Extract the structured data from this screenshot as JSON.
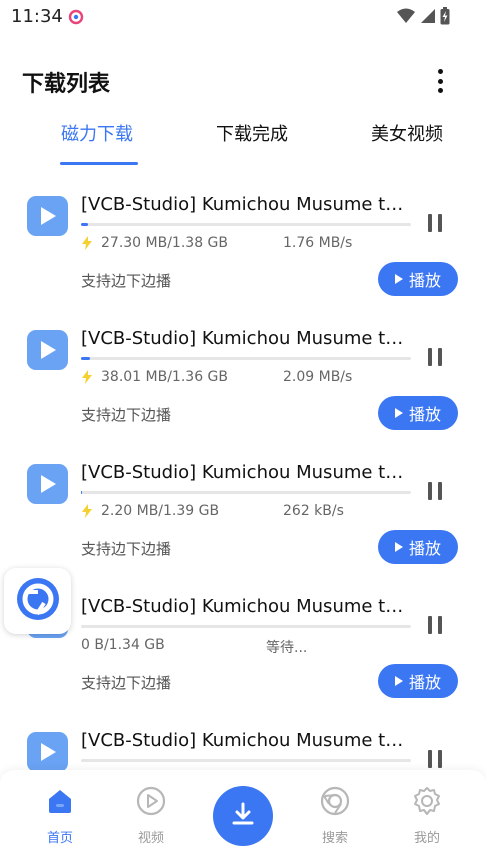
{
  "status_bar": {
    "time": "11:34",
    "icons": [
      "app-notification-icon",
      "wifi-icon",
      "cellular-signal-icon",
      "battery-charging-icon"
    ]
  },
  "header": {
    "title": "下载列表",
    "more_icon": "more-vertical-icon"
  },
  "tabs": [
    {
      "label": "磁力下载",
      "active": true
    },
    {
      "label": "下载完成",
      "active": false
    },
    {
      "label": "美女视频",
      "active": false
    }
  ],
  "downloads": [
    {
      "title": "[VCB-Studio] Kumichou Musume to S...",
      "size": "27.30 MB/1.38 GB",
      "speed": "1.76 MB/s",
      "progress": 0.02,
      "boosted": true,
      "hint": "支持边下边播",
      "play_label": "播放"
    },
    {
      "title": "[VCB-Studio] Kumichou Musume to S...",
      "size": "38.01 MB/1.36 GB",
      "speed": "2.09 MB/s",
      "progress": 0.027,
      "boosted": true,
      "hint": "支持边下边播",
      "play_label": "播放"
    },
    {
      "title": "[VCB-Studio] Kumichou Musume to S...",
      "size": "2.20 MB/1.39 GB",
      "speed": "262 kB/s",
      "progress": 0.002,
      "boosted": true,
      "hint": "支持边下边播",
      "play_label": "播放"
    },
    {
      "title": "[VCB-Studio] Kumichou Musume to S...",
      "size": "0 B/1.34 GB",
      "speed": "等待...",
      "progress": 0,
      "boosted": false,
      "hint": "支持边下边播",
      "play_label": "播放"
    },
    {
      "title": "[VCB-Studio] Kumichou Musume to S...",
      "size": "",
      "speed": "",
      "progress": 0,
      "boosted": false,
      "hint": "",
      "play_label": ""
    }
  ],
  "bottom_nav": {
    "items": [
      {
        "label": "首页",
        "icon": "home-icon",
        "active": true
      },
      {
        "label": "视频",
        "icon": "video-play-icon",
        "active": false
      },
      {
        "label": "",
        "icon": "download-icon",
        "active": false
      },
      {
        "label": "搜索",
        "icon": "browser-search-icon",
        "active": false
      },
      {
        "label": "我的",
        "icon": "settings-gear-icon",
        "active": false
      }
    ]
  },
  "colors": {
    "accent": "#3b76f3",
    "thumbnail": "#6aa3f4",
    "boost": "#f5d130",
    "inactive_nav": "#b7b7b7"
  }
}
